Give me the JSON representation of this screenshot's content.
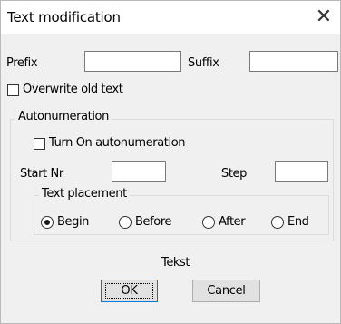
{
  "window": {
    "title": "Text modification",
    "close_glyph": "✕"
  },
  "fields": {
    "prefix_label": "Prefix",
    "prefix_value": "",
    "suffix_label": "Suffix",
    "suffix_value": ""
  },
  "overwrite": {
    "label": "Overwrite old text",
    "checked": false
  },
  "autonumeration": {
    "title": "Autonumeration",
    "turn_on_label": "Turn On autonumeration",
    "turn_on_checked": false,
    "start_label": "Start Nr",
    "start_value": "",
    "step_label": "Step",
    "step_value": ""
  },
  "placement": {
    "title": "Text placement",
    "options": [
      "Begin",
      "Before",
      "After",
      "End"
    ],
    "selected": "Begin"
  },
  "footer": {
    "text": "Tekst",
    "ok_label": "OK",
    "cancel_label": "Cancel"
  }
}
